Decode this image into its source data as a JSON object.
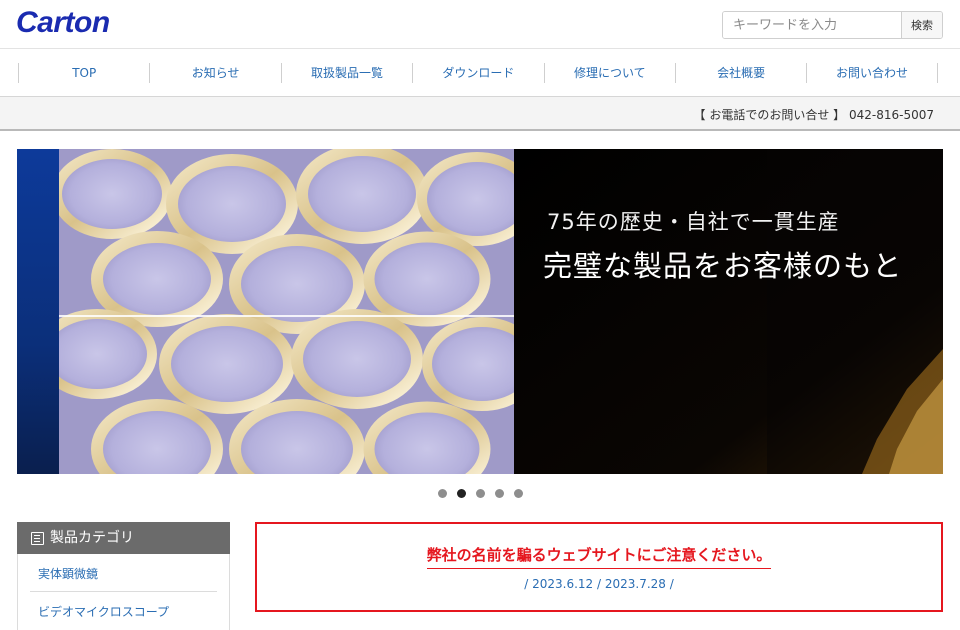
{
  "header": {
    "logo_text": "Carton",
    "search_placeholder": "キーワードを入力",
    "search_button": "検索"
  },
  "nav": {
    "items": [
      {
        "label": "TOP"
      },
      {
        "label": "お知らせ"
      },
      {
        "label": "取扱製品一覧"
      },
      {
        "label": "ダウンロード"
      },
      {
        "label": "修理について"
      },
      {
        "label": "会社概要"
      },
      {
        "label": "お問い合わせ"
      }
    ]
  },
  "phone_bar": {
    "text": "【 お電話でのお問い合せ 】 042-816-5007"
  },
  "hero": {
    "line1": "75年の歴史・自社で一貫生産",
    "line2": "完璧な製品をお客様のもと",
    "slides_count": 5,
    "active_slide": 2
  },
  "sidebar": {
    "title": "製品カテゴリ",
    "items": [
      {
        "label": "実体顕微鏡"
      },
      {
        "label": "ビデオマイクロスコープ"
      }
    ]
  },
  "notice": {
    "title": "弊社の名前を騙るウェブサイトにご注意ください。",
    "dates": "/ 2023.6.12 / 2023.7.28 /"
  },
  "colors": {
    "logo_blue": "#1a2bb0",
    "link_blue": "#2a6db3",
    "alert_red": "#e5171f",
    "sidebar_header": "#6b6b6b"
  }
}
